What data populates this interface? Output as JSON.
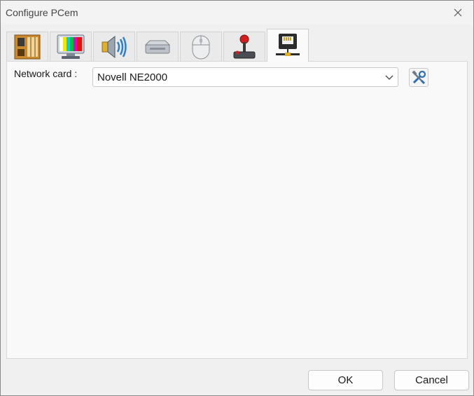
{
  "window": {
    "title": "Configure PCem"
  },
  "tabs": [
    {
      "icon": "motherboard-icon"
    },
    {
      "icon": "monitor-icon"
    },
    {
      "icon": "speaker-icon"
    },
    {
      "icon": "drive-icon"
    },
    {
      "icon": "mouse-icon"
    },
    {
      "icon": "joystick-icon"
    },
    {
      "icon": "network-icon",
      "active": true
    }
  ],
  "network": {
    "label": "Network card :",
    "selected": "Novell NE2000",
    "configure_icon": "tools-icon"
  },
  "buttons": {
    "ok": "OK",
    "cancel": "Cancel"
  }
}
